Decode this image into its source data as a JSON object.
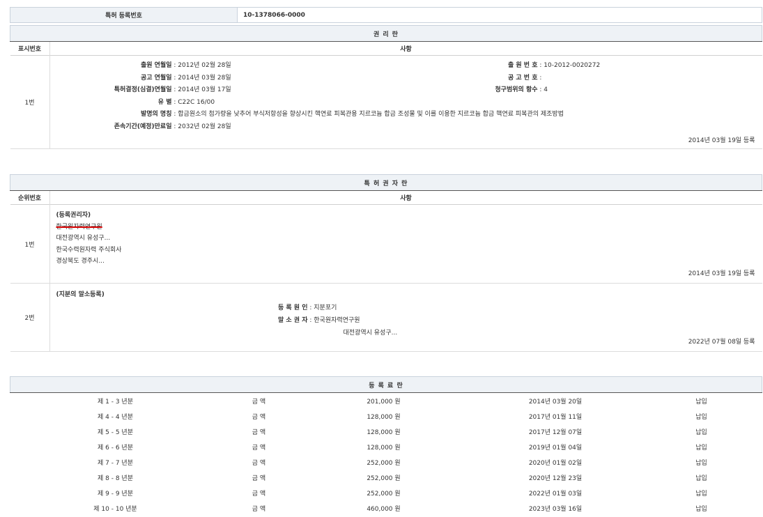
{
  "top": {
    "label": "특허 등록번호",
    "value": "10-1378066-0000"
  },
  "rights": {
    "title": "권 리 란",
    "col_num": "표시번호",
    "col_item": "사항",
    "row_no": "1번",
    "apply_date_label": "출원 연월일",
    "apply_date": "2012년 02월 28일",
    "publish_date_label": "공고 연월일",
    "publish_date": "2014년 03월 28일",
    "decision_date_label": "특허결정(심결)연월일",
    "decision_date": "2014년 03월 17일",
    "class_label": "유 별",
    "class": "C22C 16/00",
    "title_label": "발명의 명칭",
    "invention": "합금원소의 첨가량을 낮추어 부식저항성을 향상시킨 핵연료 피복관용 지르코늄 합금 조성물 및 이를 이용한 지르코늄 합금 핵연료 피복관의 제조방법",
    "expiry_label": "존속기간(예정)만료일",
    "expiry": "2032년 02월 28일",
    "app_no_label": "출 원 번 호",
    "app_no": "10-2012-0020272",
    "pub_no_label": "공 고 번 호",
    "pub_no": "",
    "claims_label": "청구범위의 항수",
    "claims": "4",
    "reg_date": "2014년 03월 19일 등록"
  },
  "holders": {
    "title": "특 허 권 자 란",
    "col_num": "순위번호",
    "col_item": "사항",
    "r1": {
      "no": "1번",
      "heading": "(등록권리자)",
      "struck": "한국원자력연구원",
      "l1": "대전광역시 유성구...",
      "l2": "한국수력원자력 주식회사",
      "l3": "경상북도 경주시...",
      "reg": "2014년 03월 19일 등록"
    },
    "r2": {
      "no": "2번",
      "heading": "(지분의 말소등록)",
      "cause_label": "등 록 원 인",
      "cause": "지분포기",
      "cancel_label": "말 소 권 자",
      "cancel": "한국원자력연구원",
      "cancel_addr": "대전광역시 유성구...",
      "reg": "2022년 07월 08일 등록"
    }
  },
  "fees": {
    "title": "등 록 료 란",
    "rows": [
      {
        "period": "제 1 - 3 년분",
        "label": "금 액",
        "amount": "201,000 원",
        "date": "2014년 03월 20일",
        "status": "납입"
      },
      {
        "period": "제 4 - 4 년분",
        "label": "금 액",
        "amount": "128,000 원",
        "date": "2017년 01월 11일",
        "status": "납입"
      },
      {
        "period": "제 5 - 5 년분",
        "label": "금 액",
        "amount": "128,000 원",
        "date": "2017년 12월 07일",
        "status": "납입"
      },
      {
        "period": "제 6 - 6 년분",
        "label": "금 액",
        "amount": "128,000 원",
        "date": "2019년 01월 04일",
        "status": "납입"
      },
      {
        "period": "제 7 - 7 년분",
        "label": "금 액",
        "amount": "252,000 원",
        "date": "2020년 01월 02일",
        "status": "납입"
      },
      {
        "period": "제 8 - 8 년분",
        "label": "금 액",
        "amount": "252,000 원",
        "date": "2020년 12월 23일",
        "status": "납입"
      },
      {
        "period": "제 9 - 9 년분",
        "label": "금 액",
        "amount": "252,000 원",
        "date": "2022년 01월 03일",
        "status": "납입"
      },
      {
        "period": "제 10 - 10 년분",
        "label": "금 액",
        "amount": "460,000 원",
        "date": "2023년 03월 16일",
        "status": "납입"
      }
    ]
  }
}
